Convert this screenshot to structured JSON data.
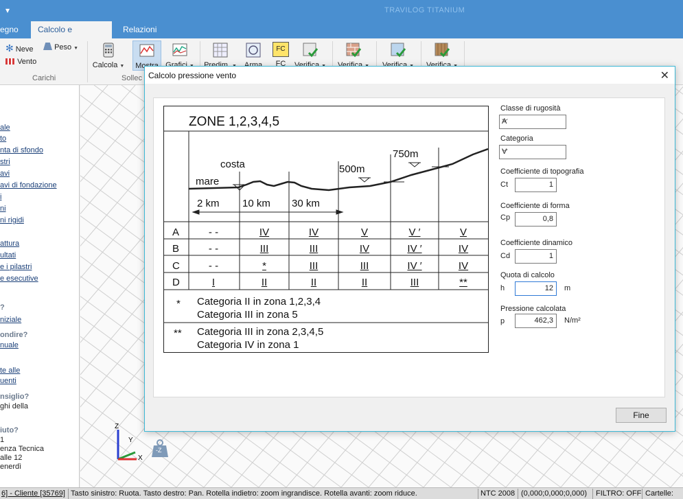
{
  "app": {
    "title": "TRAVILOG TITANIUM",
    "quick_access": "▾"
  },
  "tabs": [
    "egno",
    "Calcolo e verifiche",
    "Relazioni"
  ],
  "ribbon": {
    "neve": "Neve",
    "peso": "Peso",
    "vento": "Vento",
    "calcola": "Calcola",
    "mostra": "Mostra",
    "grafici": "Grafici",
    "predim": "Predim.",
    "arma": "Arma",
    "fc_icon": "FC",
    "fc": "FC",
    "verifica1": "Verifica",
    "verifica2": "Verifica",
    "verifica3": "Verifica",
    "verifica4": "Verifica",
    "group_carichi": "Carichi",
    "group_sollec": "Sollec"
  },
  "left_panel": {
    "links": [
      "ale",
      "to",
      "nta di sfondo",
      "stri",
      "avi",
      "avi di fondazione",
      "i",
      "ni",
      "ni rigidi",
      "attura",
      "ultati",
      "e i pilastri",
      "e esecutive"
    ],
    "head1": "?",
    "link2": "niziale",
    "head2": "ondire?",
    "link3": "nuale",
    "link4a": "te alle",
    "link4b": "uenti",
    "head3": "nsiglio?",
    "text3": "ghi della",
    "head4": "iuto?",
    "text4a": "1",
    "text4b": "enza Tecnica",
    "text4c": "alle 12",
    "text4d": "enerdì"
  },
  "status_bar": {
    "item1": "6] - Cliente [35769]",
    "hint": "Tasto sinistro: Ruota. Tasto destro: Pan. Rotella indietro: zoom ingrandisce. Rotella avanti: zoom riduce.",
    "norm": "NTC 2008",
    "coords": "(0,000;0,000;0,000)",
    "filter": "FILTRO: OFF",
    "cartelle": "Cartelle:"
  },
  "axes": {
    "z": "Z",
    "y": "Y",
    "x": "X",
    "neg_z": "-Z"
  },
  "dialog": {
    "title": "Calcolo pressione vento",
    "close": "✕",
    "fine_button": "Fine",
    "form": {
      "rugosita_label": "Classe di rugosità",
      "rugosita_value": "A",
      "categoria_label": "Categoria",
      "categoria_value": "V",
      "topografia_label": "Coefficiente di topografia",
      "ct_label": "Ct",
      "ct_value": "1",
      "forma_label": "Coefficiente di forma",
      "cp_label": "Cp",
      "cp_value": "0,8",
      "dinamico_label": "Coefficiente dinamico",
      "cd_label": "Cd",
      "cd_value": "1",
      "quota_label": "Quota di calcolo",
      "h_label": "h",
      "h_value": "12",
      "h_unit": "m",
      "pressione_label": "Pressione calcolata",
      "p_label": "p",
      "p_value": "462,3",
      "p_unit": "N/m²"
    },
    "zone_table": {
      "title": "ZONE   1,2,3,4,5",
      "mare": "mare",
      "costa": "costa",
      "m500": "500m",
      "m750": "750m",
      "d2": "2 km",
      "d10": "10 km",
      "d30": "30 km",
      "rows": [
        {
          "label": "A",
          "cells": [
            "- -",
            "IV",
            "IV",
            "V",
            "V ′",
            "V"
          ]
        },
        {
          "label": "B",
          "cells": [
            "- -",
            "III",
            "III",
            "IV",
            "IV ′",
            "IV"
          ]
        },
        {
          "label": "C",
          "cells": [
            "- -",
            "*",
            "III",
            "III",
            "IV ′",
            "IV"
          ]
        },
        {
          "label": "D",
          "cells": [
            "I",
            "II",
            "II",
            "II",
            "III",
            "**"
          ]
        }
      ],
      "note1_sym": "*",
      "note1_l1": "Categoria II in zona 1,2,3,4",
      "note1_l2": "Categoria III in zona 5",
      "note2_sym": "**",
      "note2_l1": "Categoria III in zona 2,3,4,5",
      "note2_l2": "Categoria IV in zona 1"
    }
  }
}
